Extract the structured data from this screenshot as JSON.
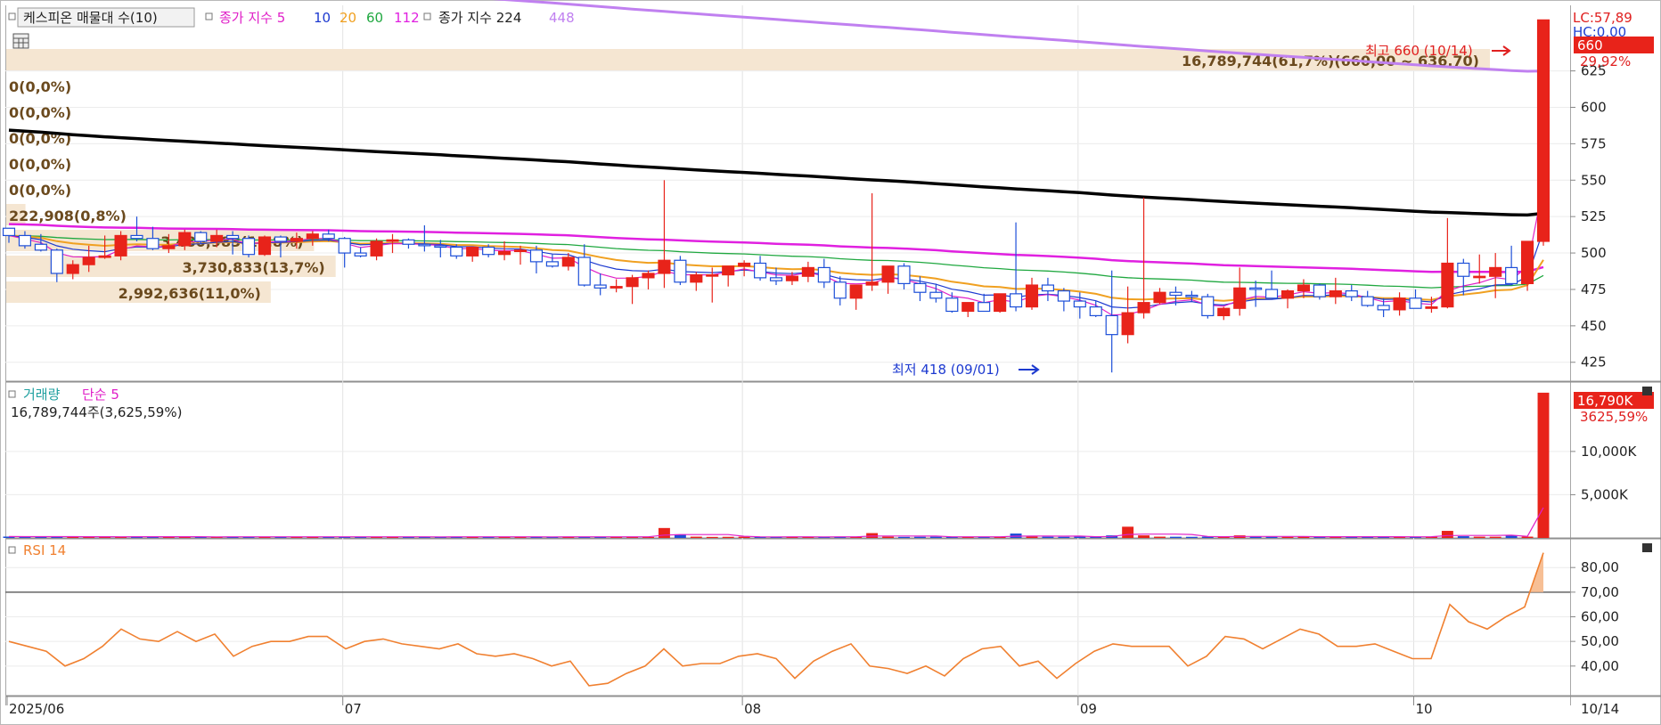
{
  "legend": {
    "price_indicator": "케스피온 매물대 수(10)",
    "ma_label_1": "종가 지수 5",
    "ma_values_1": [
      "10",
      "20",
      "60",
      "112"
    ],
    "ma_label_2": "종가 지수 224",
    "ma_value_2": "448",
    "volume_label": "거래량",
    "volume_ma": "단순 5",
    "volume_info": "16,789,744주(3,625,59%)",
    "rsi_label": "RSI 14"
  },
  "price_axis": {
    "ticks": [
      "625",
      "600",
      "575",
      "550",
      "525",
      "500",
      "475",
      "450",
      "425"
    ],
    "lc_label": "LC:57,89",
    "hc_label": "HC:0,00",
    "last_price": "660",
    "change_pct": "29,92%"
  },
  "volume_axis": {
    "ticks": [
      "10,000K",
      "5,000K"
    ],
    "last_volume": "16,790K",
    "last_ratio": "3625,59%"
  },
  "rsi_axis": {
    "ticks": [
      "80,00",
      "70,00",
      "60,00",
      "50,00",
      "40,00"
    ]
  },
  "date_axis": {
    "labels": [
      "2025/06",
      "07",
      "08",
      "09",
      "10"
    ],
    "last_date": "10/14"
  },
  "annotations": {
    "high": "최고 660 (10/14)",
    "low": "최저 418 (09/01)"
  },
  "volume_profile": [
    {
      "label": "16,789,744(61,7%)(660,00 ~ 636,70)",
      "pct": 61.7
    },
    {
      "label": "0(0,0%)",
      "pct": 0
    },
    {
      "label": "0(0,0%)",
      "pct": 0
    },
    {
      "label": "0(0,0%)",
      "pct": 0
    },
    {
      "label": "0(0,0%)",
      "pct": 0
    },
    {
      "label": "0(0,0%)",
      "pct": 0
    },
    {
      "label": "222,908(0,8%)",
      "pct": 0.8
    },
    {
      "label": "3,480,983(12,8%)",
      "pct": 12.8
    },
    {
      "label": "3,730,833(13,7%)",
      "pct": 13.7
    },
    {
      "label": "2,992,636(11,0%)",
      "pct": 11.0
    }
  ],
  "colors": {
    "up": "#e8231a",
    "down": "#1d4fd8",
    "ma5": "#e020c8",
    "ma10": "#1d3ad0",
    "ma20": "#f0a020",
    "ma60": "#20a840",
    "ma112": "#e020e0",
    "ma224": "#000000",
    "ma448": "#c080f0",
    "rsi": "#f08030",
    "profile": "#f5e6d2"
  },
  "chart_data": [
    {
      "type": "candlestick",
      "title": "",
      "ylim": [
        412,
        670
      ],
      "ohlc": [
        [
          517,
          513,
          507,
          512
        ],
        [
          512,
          515,
          503,
          505
        ],
        [
          506,
          513,
          501,
          502
        ],
        [
          502,
          503,
          480,
          486
        ],
        [
          486,
          495,
          482,
          492
        ],
        [
          492,
          505,
          487,
          497
        ],
        [
          497,
          512,
          496,
          498
        ],
        [
          498,
          515,
          495,
          512
        ],
        [
          512,
          525,
          508,
          510
        ],
        [
          510,
          518,
          502,
          503
        ],
        [
          503,
          513,
          500,
          505
        ],
        [
          505,
          516,
          502,
          514
        ],
        [
          514,
          515,
          506,
          508
        ],
        [
          508,
          516,
          504,
          512
        ],
        [
          512,
          515,
          499,
          510
        ],
        [
          510,
          512,
          497,
          499
        ],
        [
          499,
          512,
          498,
          511
        ],
        [
          511,
          512,
          497,
          508
        ],
        [
          508,
          514,
          503,
          510
        ],
        [
          510,
          515,
          505,
          513
        ],
        [
          513,
          516,
          508,
          510
        ],
        [
          510,
          511,
          490,
          500
        ],
        [
          500,
          504,
          497,
          498
        ],
        [
          498,
          510,
          495,
          508
        ],
        [
          508,
          513,
          500,
          509
        ],
        [
          509,
          510,
          503,
          506
        ],
        [
          506,
          519,
          501,
          505
        ],
        [
          505,
          509,
          497,
          504
        ],
        [
          504,
          506,
          496,
          498
        ],
        [
          498,
          502,
          494,
          504
        ],
        [
          504,
          506,
          497,
          499
        ],
        [
          499,
          508,
          495,
          501
        ],
        [
          501,
          505,
          492,
          502
        ],
        [
          502,
          505,
          486,
          494
        ],
        [
          494,
          499,
          490,
          491
        ],
        [
          491,
          500,
          488,
          497
        ],
        [
          497,
          506,
          477,
          478
        ],
        [
          478,
          486,
          471,
          476
        ],
        [
          476,
          482,
          473,
          477
        ],
        [
          477,
          485,
          465,
          483
        ],
        [
          483,
          488,
          475,
          486
        ],
        [
          486,
          550,
          476,
          495
        ],
        [
          495,
          498,
          478,
          480
        ],
        [
          480,
          487,
          474,
          485
        ],
        [
          485,
          490,
          466,
          485
        ],
        [
          485,
          491,
          477,
          491
        ],
        [
          491,
          495,
          484,
          493
        ],
        [
          493,
          498,
          481,
          483
        ],
        [
          483,
          490,
          478,
          481
        ],
        [
          481,
          487,
          478,
          484
        ],
        [
          484,
          494,
          480,
          490
        ],
        [
          490,
          496,
          476,
          480
        ],
        [
          480,
          484,
          464,
          469
        ],
        [
          469,
          473,
          461,
          478
        ],
        [
          478,
          541,
          474,
          480
        ],
        [
          480,
          487,
          472,
          491
        ],
        [
          491,
          493,
          475,
          479
        ],
        [
          479,
          484,
          467,
          473
        ],
        [
          473,
          479,
          466,
          469
        ],
        [
          469,
          473,
          459,
          460
        ],
        [
          460,
          466,
          456,
          466
        ],
        [
          466,
          472,
          460,
          460
        ],
        [
          460,
          472,
          459,
          472
        ],
        [
          472,
          521,
          460,
          463
        ],
        [
          463,
          483,
          461,
          478
        ],
        [
          478,
          483,
          467,
          474
        ],
        [
          474,
          476,
          460,
          467
        ],
        [
          467,
          473,
          455,
          463
        ],
        [
          463,
          467,
          456,
          457
        ],
        [
          457,
          488,
          418,
          444
        ],
        [
          444,
          477,
          438,
          459
        ],
        [
          459,
          538,
          455,
          466
        ],
        [
          466,
          476,
          465,
          473
        ],
        [
          473,
          477,
          464,
          471
        ],
        [
          471,
          474,
          467,
          470
        ],
        [
          470,
          472,
          455,
          457
        ],
        [
          457,
          463,
          454,
          462
        ],
        [
          462,
          490,
          457,
          476
        ],
        [
          476,
          481,
          463,
          475
        ],
        [
          475,
          488,
          471,
          469
        ],
        [
          469,
          475,
          462,
          474
        ],
        [
          474,
          482,
          469,
          478
        ],
        [
          478,
          479,
          468,
          470
        ],
        [
          470,
          483,
          465,
          474
        ],
        [
          474,
          478,
          467,
          470
        ],
        [
          470,
          474,
          463,
          464
        ],
        [
          464,
          469,
          456,
          461
        ],
        [
          461,
          473,
          457,
          469
        ],
        [
          469,
          475,
          464,
          462
        ],
        [
          462,
          470,
          459,
          463
        ],
        [
          463,
          524,
          462,
          493
        ],
        [
          493,
          496,
          471,
          484
        ],
        [
          484,
          499,
          479,
          484
        ],
        [
          484,
          500,
          469,
          490
        ],
        [
          490,
          505,
          478,
          479
        ],
        [
          479,
          508,
          474,
          508
        ],
        [
          508,
          660,
          505,
          660
        ]
      ],
      "moving_averages": [
        "5",
        "10",
        "20",
        "60",
        "112",
        "224",
        "448"
      ]
    },
    {
      "type": "bar",
      "title": "거래량",
      "unit": "K",
      "ylim": [
        0,
        17500
      ],
      "values": [
        160,
        150,
        140,
        170,
        130,
        120,
        150,
        120,
        200,
        130,
        120,
        140,
        120,
        130,
        150,
        120,
        140,
        130,
        120,
        140,
        130,
        150,
        140,
        120,
        130,
        140,
        120,
        130,
        150,
        140,
        120,
        130,
        140,
        120,
        130,
        150,
        140,
        120,
        130,
        140,
        120,
        1150,
        420,
        150,
        120,
        130,
        140,
        120,
        130,
        140,
        120,
        130,
        150,
        140,
        560,
        150,
        120,
        130,
        140,
        130,
        150,
        140,
        120,
        510,
        150,
        140,
        130,
        150,
        140,
        300,
        1300,
        300,
        150,
        140,
        130,
        150,
        140,
        300,
        150,
        140,
        130,
        150,
        140,
        150,
        140,
        130,
        150,
        140,
        130,
        150,
        820,
        200,
        150,
        140,
        300,
        150,
        16790
      ]
    },
    {
      "type": "line",
      "title": "RSI 14",
      "ylim": [
        28,
        92
      ],
      "reference": 70,
      "values": [
        50,
        48,
        46,
        40,
        43,
        48,
        55,
        51,
        50,
        54,
        50,
        53,
        44,
        48,
        50,
        50,
        52,
        52,
        47,
        50,
        51,
        49,
        48,
        47,
        49,
        45,
        44,
        45,
        43,
        40,
        42,
        32,
        33,
        37,
        40,
        47,
        40,
        41,
        41,
        44,
        45,
        43,
        35,
        42,
        46,
        49,
        40,
        39,
        37,
        40,
        36,
        43,
        47,
        48,
        40,
        42,
        35,
        41,
        46,
        49,
        48,
        48,
        48,
        40,
        44,
        52,
        51,
        47,
        51,
        55,
        53,
        48,
        48,
        49,
        46,
        43,
        43,
        65,
        58,
        55,
        60,
        64,
        86
      ]
    }
  ]
}
